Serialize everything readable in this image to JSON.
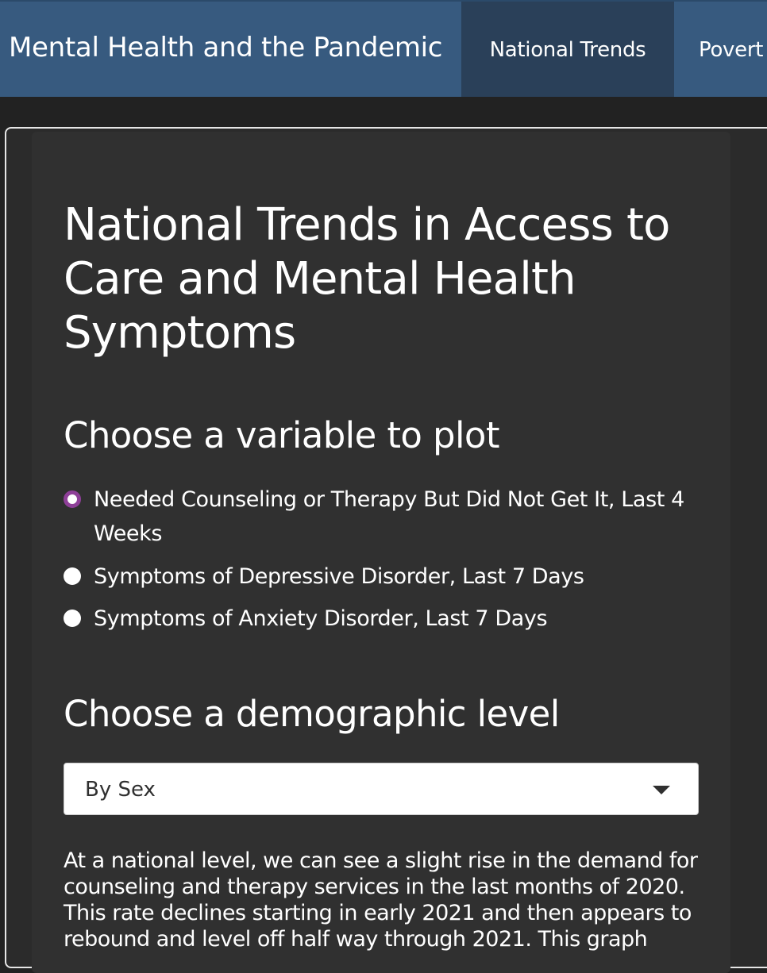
{
  "navbar": {
    "brand": "Mental Health and the Pandemic",
    "tabs": [
      {
        "label": "National Trends",
        "active": true
      },
      {
        "label": "Povert",
        "active": false
      }
    ],
    "bg_color": "#375a7f",
    "active_tab_color": "#2a4059"
  },
  "main": {
    "title": "National Trends in Access to Care and Mental Health Symptoms",
    "variable_heading": "Choose a variable to plot",
    "variable_options": [
      {
        "label": "Needed Counseling or Therapy But Did Not Get It, Last 4 Weeks",
        "selected": true
      },
      {
        "label": "Symptoms of Depressive Disorder, Last 7 Days",
        "selected": false
      },
      {
        "label": "Symptoms of Anxiety Disorder, Last 7 Days",
        "selected": false
      }
    ],
    "demographic_heading": "Choose a demographic level",
    "demographic_select": {
      "value": "By Sex"
    },
    "description": "At a national level, we can see a slight rise in the demand for counseling and therapy services in the last months of 2020. This rate declines starting in early 2021 and then appears to rebound and level off half way through 2021. This graph"
  },
  "colors": {
    "page_bg": "#222222",
    "panel_bg": "#303030",
    "radio_accent": "#8e3f98"
  }
}
